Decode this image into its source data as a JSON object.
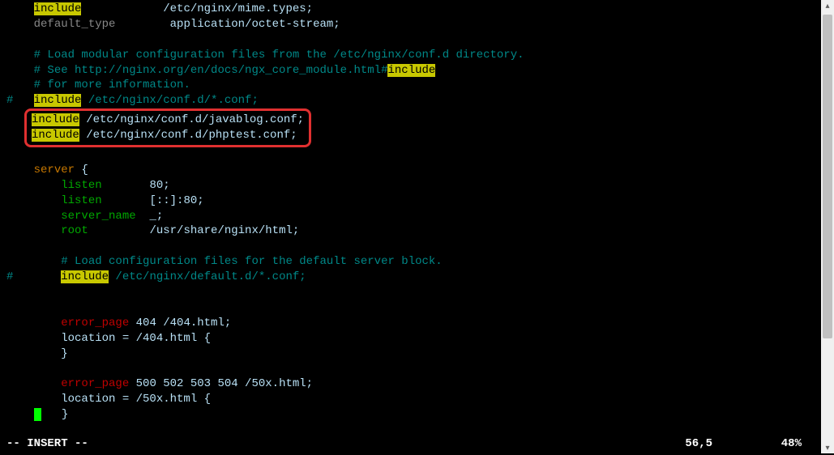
{
  "lines": {
    "l1_kw": "include",
    "l1_rest": "            /etc/nginx/mime.types;",
    "l2a": "default_type",
    "l2b": "        application/octet-stream;",
    "l3": "# Load modular configuration files from the /etc/nginx/conf.d directory.",
    "l4a": "# See http://nginx.org/en/docs/ngx_core_module.html#",
    "l4kw": "include",
    "l5": "# for more information.",
    "l6a": "#   ",
    "l6kw": "include",
    "l6b": " /etc/nginx/conf.d/*.conf;",
    "l7kw": "include",
    "l7b": " /etc/nginx/conf.d/javablog.conf;",
    "l8kw": "include",
    "l8b": " /etc/nginx/conf.d/phptest.conf;",
    "l9a": "server",
    "l9b": " {",
    "l10a": "listen",
    "l10b": "       80;",
    "l11a": "listen",
    "l11b": "       [::]:80;",
    "l12a": "server_name",
    "l12b": "  _;",
    "l13a": "root",
    "l13b": "         /usr/share/nginx/html;",
    "l14": "# Load configuration files for the default server block.",
    "l15a": "#       ",
    "l15kw": "include",
    "l15b": " /etc/nginx/default.d/*.conf;",
    "l16a": "error_page",
    "l16b": " 404 /404.html;",
    "l17": "        location = /404.html {",
    "l18": "        }",
    "l19a": "error_page",
    "l19b": " 500 502 503 504 /50x.html;",
    "l20": "        location = /50x.html {",
    "l21": "}"
  },
  "status": {
    "mode": "-- INSERT --",
    "position": "56,5",
    "percent": "48%"
  }
}
